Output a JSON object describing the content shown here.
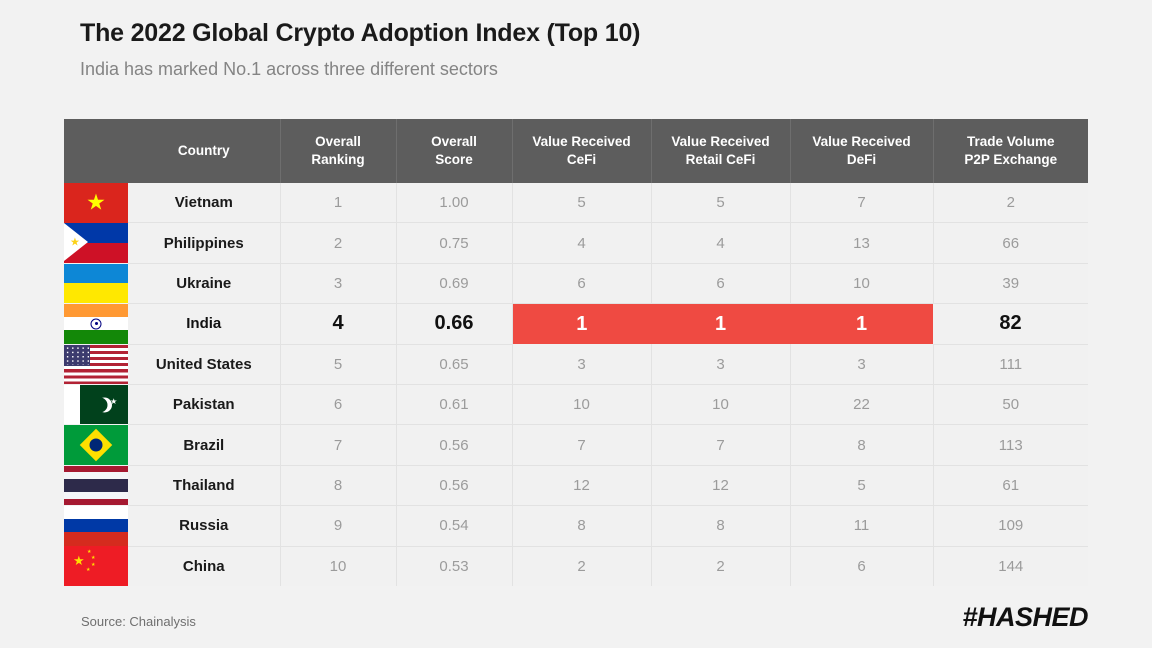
{
  "header": {
    "title": "The 2022 Global Crypto Adoption Index (Top 10)",
    "subtitle": "India has marked No.1 across three different sectors"
  },
  "footer": {
    "source": "Source: Chainalysis",
    "logo": "#HASHED"
  },
  "colors": {
    "page_background": "#f2f2f2",
    "header_row": "#5d5d5d",
    "row_background": "#f1f1f1",
    "highlight_red": "#ef4a42",
    "muted_text": "#9b9b9b",
    "strong_text": "#1a1a1a"
  },
  "chart_data": {
    "type": "table",
    "title": "The 2022 Global Crypto Adoption Index (Top 10)",
    "subtitle": "India has marked No.1 across three different sectors",
    "source": "Source: Chainalysis",
    "columns": [
      "Country",
      "Overall Ranking",
      "Overall Score",
      "Value Received CeFi",
      "Value Received Retail CeFi",
      "Value Received DeFi",
      "Trade Volume P2P Exchange"
    ],
    "highlighted_row": "India",
    "highlighted_columns": [
      "Value Received CeFi",
      "Value Received Retail CeFi",
      "Value Received DeFi"
    ],
    "rows": [
      {
        "flag": "vn",
        "country": "Vietnam",
        "overall_ranking": "1",
        "overall_score": "1.00",
        "cefi": "5",
        "retail_cefi": "5",
        "defi": "7",
        "p2p": "2"
      },
      {
        "flag": "ph",
        "country": "Philippines",
        "overall_ranking": "2",
        "overall_score": "0.75",
        "cefi": "4",
        "retail_cefi": "4",
        "defi": "13",
        "p2p": "66"
      },
      {
        "flag": "ua",
        "country": "Ukraine",
        "overall_ranking": "3",
        "overall_score": "0.69",
        "cefi": "6",
        "retail_cefi": "6",
        "defi": "10",
        "p2p": "39"
      },
      {
        "flag": "in",
        "country": "India",
        "overall_ranking": "4",
        "overall_score": "0.66",
        "cefi": "1",
        "retail_cefi": "1",
        "defi": "1",
        "p2p": "82"
      },
      {
        "flag": "us",
        "country": "United States",
        "overall_ranking": "5",
        "overall_score": "0.65",
        "cefi": "3",
        "retail_cefi": "3",
        "defi": "3",
        "p2p": "111"
      },
      {
        "flag": "pk",
        "country": "Pakistan",
        "overall_ranking": "6",
        "overall_score": "0.61",
        "cefi": "10",
        "retail_cefi": "10",
        "defi": "22",
        "p2p": "50"
      },
      {
        "flag": "br",
        "country": "Brazil",
        "overall_ranking": "7",
        "overall_score": "0.56",
        "cefi": "7",
        "retail_cefi": "7",
        "defi": "8",
        "p2p": "113"
      },
      {
        "flag": "th",
        "country": "Thailand",
        "overall_ranking": "8",
        "overall_score": "0.56",
        "cefi": "12",
        "retail_cefi": "12",
        "defi": "5",
        "p2p": "61"
      },
      {
        "flag": "ru",
        "country": "Russia",
        "overall_ranking": "9",
        "overall_score": "0.54",
        "cefi": "8",
        "retail_cefi": "8",
        "defi": "11",
        "p2p": "109"
      },
      {
        "flag": "cn",
        "country": "China",
        "overall_ranking": "10",
        "overall_score": "0.53",
        "cefi": "2",
        "retail_cefi": "2",
        "defi": "6",
        "p2p": "144"
      }
    ]
  },
  "table": {
    "headers": {
      "country": "Country",
      "overall_ranking_l1": "Overall",
      "overall_ranking_l2": "Ranking",
      "overall_score_l1": "Overall",
      "overall_score_l2": "Score",
      "cefi_l1": "Value Received",
      "cefi_l2": "CeFi",
      "retail_l1": "Value Received",
      "retail_l2": "Retail CeFi",
      "defi_l1": "Value Received",
      "defi_l2": "DeFi",
      "p2p_l1": "Trade Volume",
      "p2p_l2": "P2P Exchange"
    }
  }
}
